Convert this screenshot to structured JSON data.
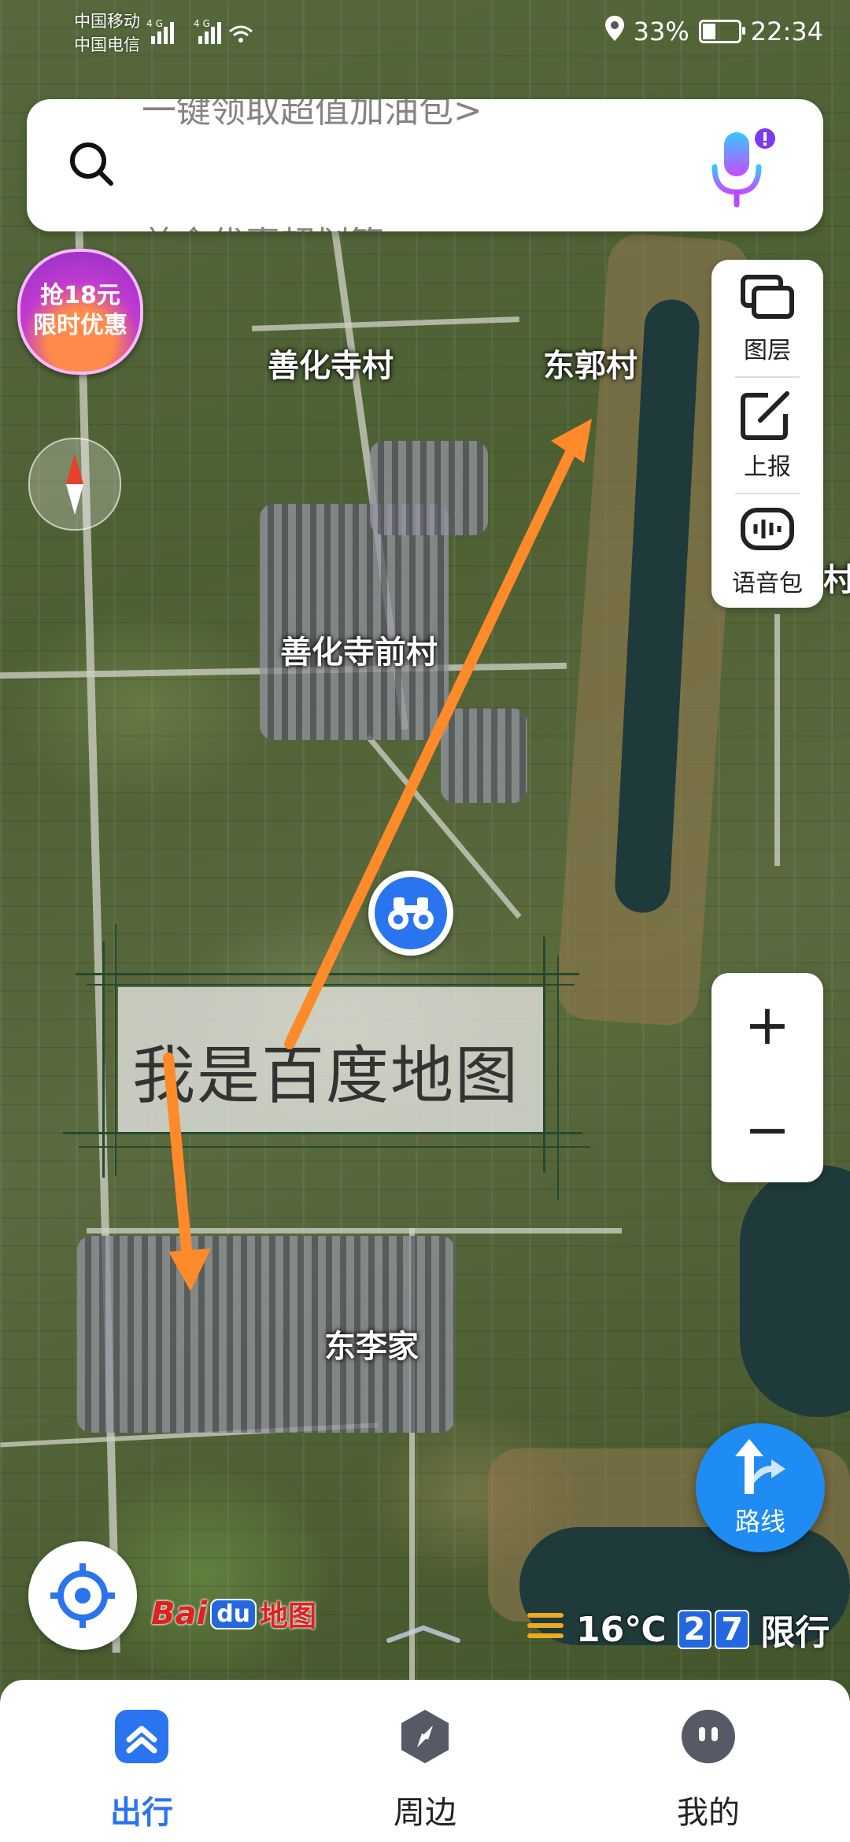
{
  "status_bar": {
    "carrier1": "中国移动",
    "carrier2": "中国电信",
    "signal_text": "4G 4G",
    "battery": "33%",
    "time": "22:34"
  },
  "search": {
    "scroll_top_text": "一键领取超值加油包>",
    "scroll_bottom_text": "美食优惠超划算"
  },
  "promo": {
    "line1": "抢18元",
    "line2": "限时优惠"
  },
  "map_labels": {
    "shanhuasi": "善化寺村",
    "dongguo": "东郭村",
    "shanhuasiqian": "善化寺前村",
    "dongli": "东李家",
    "edge_label": "村"
  },
  "tools": {
    "layers": "图层",
    "report": "上报",
    "voice_pack": "语音包"
  },
  "watermark": {
    "text": "我是百度地图"
  },
  "zoom": {
    "in": "+",
    "out": "−"
  },
  "route": {
    "label": "路线"
  },
  "logo": {
    "bai": "Bai",
    "du": "du",
    "map": "地图"
  },
  "weather": {
    "temperature": "16℃",
    "plate1": "2",
    "plate2": "7",
    "restriction": "限行"
  },
  "nav": {
    "travel": "出行",
    "nearby": "周边",
    "mine": "我的"
  },
  "colors": {
    "accent": "#2a74f0",
    "route_btn": "#1e8cf2",
    "arrow": "#ff8a2a"
  }
}
